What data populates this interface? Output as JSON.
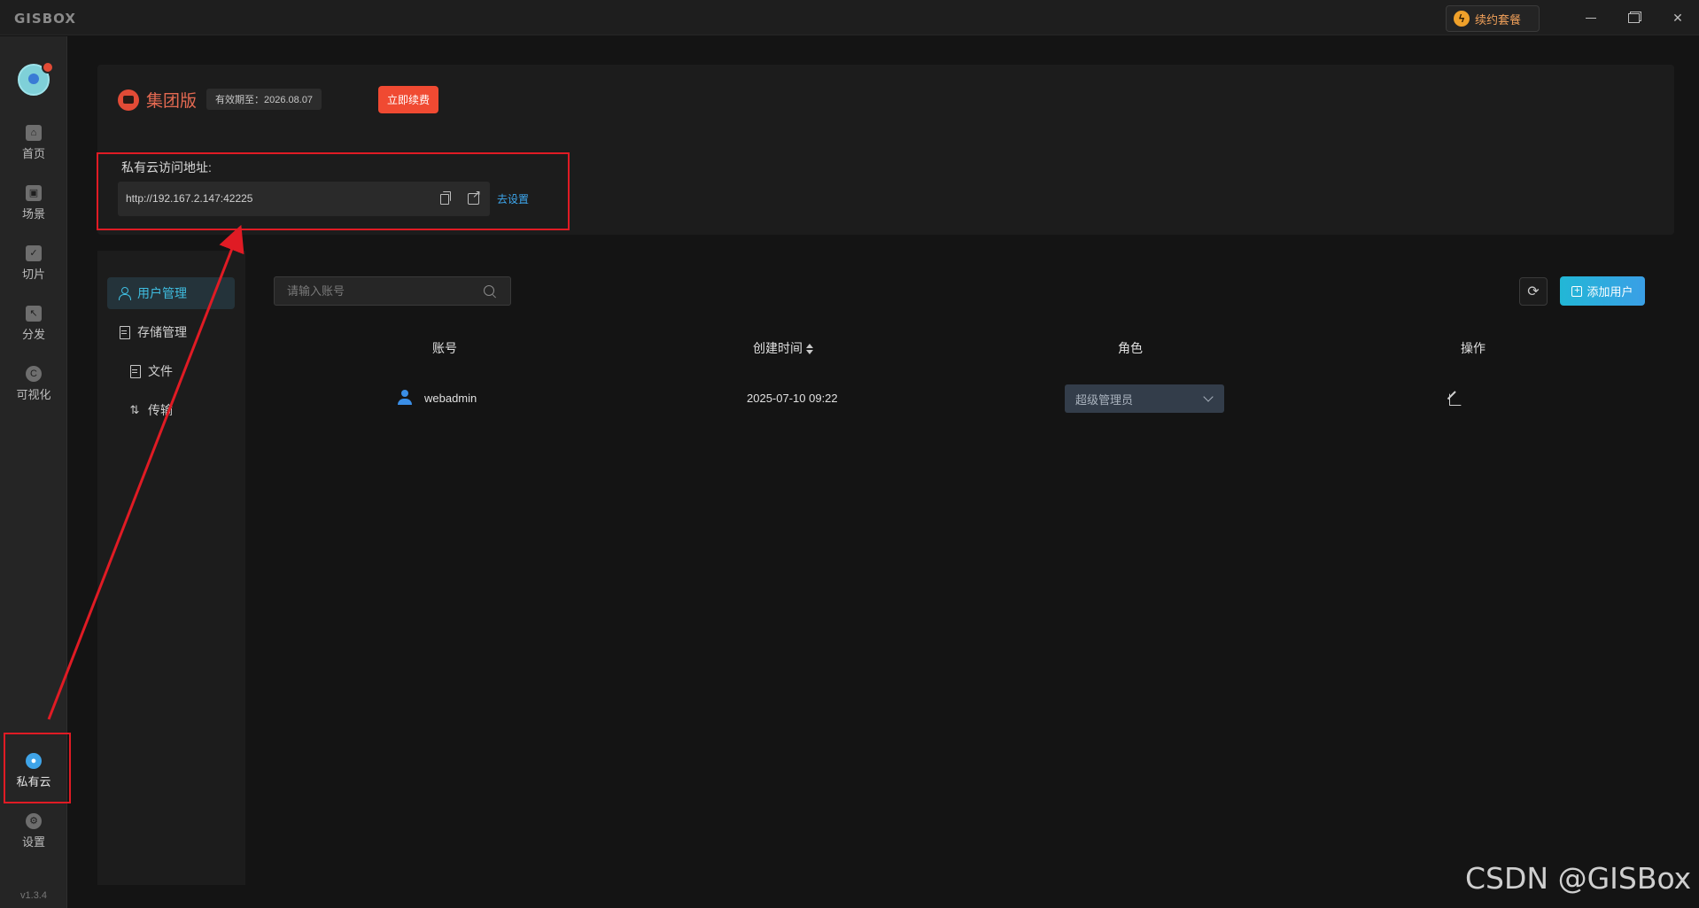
{
  "app": {
    "logo": "GISBOX",
    "renew_package": "续约套餐",
    "version": "v1.3.4"
  },
  "nav": {
    "items": [
      {
        "label": "首页",
        "icon": "home-icon"
      },
      {
        "label": "场景",
        "icon": "cube-icon"
      },
      {
        "label": "切片",
        "icon": "tile-icon"
      },
      {
        "label": "分发",
        "icon": "publish-icon"
      },
      {
        "label": "可视化",
        "icon": "visual-icon"
      },
      {
        "label": "私有云",
        "icon": "cloud-lock-icon",
        "active": true
      },
      {
        "label": "设置",
        "icon": "settings-icon"
      }
    ]
  },
  "license": {
    "edition": "集团版",
    "expiry": "有效期至：2026.08.07",
    "renew_button": "立即续费"
  },
  "private_cloud": {
    "url_label": "私有云访问地址:",
    "url": "http://192.167.2.147:42225",
    "settings_link": "去设置"
  },
  "submenu": {
    "user_mgmt": "用户管理",
    "storage_mgmt": "存储管理",
    "files": "文件",
    "transfer": "传输"
  },
  "toolbar": {
    "search_placeholder": "请输入账号",
    "add_user": "添加用户"
  },
  "table": {
    "headers": [
      "账号",
      "创建时间",
      "角色",
      "操作"
    ],
    "rows": [
      {
        "account": "webadmin",
        "created": "2025-07-10 09:22",
        "role": "超级管理员"
      }
    ]
  },
  "watermark": "CSDN @GISBox",
  "colors": {
    "accent": "#3fbde0",
    "brand_red": "#f04a32",
    "annotation_red": "#e01b24"
  }
}
